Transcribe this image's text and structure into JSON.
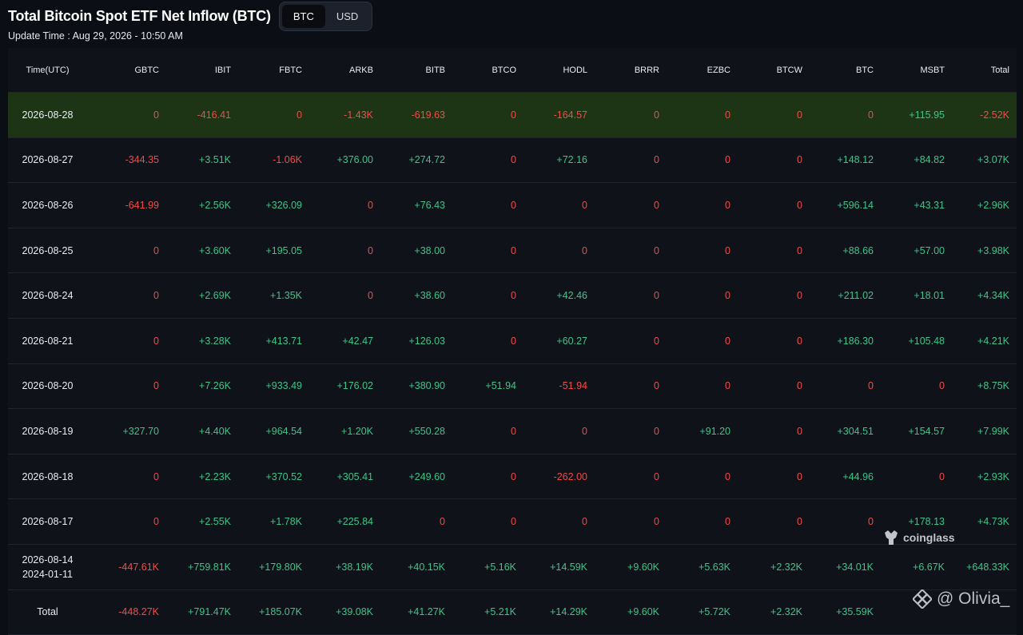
{
  "header": {
    "title": "Total Bitcoin Spot ETF Net Inflow (BTC)",
    "toggle": [
      "BTC",
      "USD"
    ],
    "active": "BTC",
    "update_time": "Update Time : Aug 29, 2026 - 10:50 AM"
  },
  "columns": [
    "Time(UTC)",
    "GBTC",
    "IBIT",
    "FBTC",
    "ARKB",
    "BITB",
    "BTCO",
    "HODL",
    "BRRR",
    "EZBC",
    "BTCW",
    "BTC",
    "MSBT",
    "Total"
  ],
  "rows": [
    {
      "date": "2026-08-28",
      "values": [
        "0",
        "-416.41",
        "0",
        "-1.43K",
        "-619.63",
        "0",
        "-164.57",
        "0",
        "0",
        "0",
        "0",
        "+115.95",
        "-2.52K"
      ]
    },
    {
      "date": "2026-08-27",
      "values": [
        "-344.35",
        "+3.51K",
        "-1.06K",
        "+376.00",
        "+274.72",
        "0",
        "+72.16",
        "0",
        "0",
        "0",
        "+148.12",
        "+84.82",
        "+3.07K"
      ]
    },
    {
      "date": "2026-08-26",
      "values": [
        "-641.99",
        "+2.56K",
        "+326.09",
        "0",
        "+76.43",
        "0",
        "0",
        "0",
        "0",
        "0",
        "+596.14",
        "+43.31",
        "+2.96K"
      ]
    },
    {
      "date": "2026-08-25",
      "values": [
        "0",
        "+3.60K",
        "+195.05",
        "0",
        "+38.00",
        "0",
        "0",
        "0",
        "0",
        "0",
        "+88.66",
        "+57.00",
        "+3.98K"
      ]
    },
    {
      "date": "2026-08-24",
      "values": [
        "0",
        "+2.69K",
        "+1.35K",
        "0",
        "+38.60",
        "0",
        "+42.46",
        "0",
        "0",
        "0",
        "+211.02",
        "+18.01",
        "+4.34K"
      ]
    },
    {
      "date": "2026-08-21",
      "values": [
        "0",
        "+3.28K",
        "+413.71",
        "+42.47",
        "+126.03",
        "0",
        "+60.27",
        "0",
        "0",
        "0",
        "+186.30",
        "+105.48",
        "+4.21K"
      ]
    },
    {
      "date": "2026-08-20",
      "values": [
        "0",
        "+7.26K",
        "+933.49",
        "+176.02",
        "+380.90",
        "+51.94",
        "-51.94",
        "0",
        "0",
        "0",
        "0",
        "0",
        "+8.75K"
      ]
    },
    {
      "date": "2026-08-19",
      "values": [
        "+327.70",
        "+4.40K",
        "+964.54",
        "+1.20K",
        "+550.28",
        "0",
        "0",
        "0",
        "+91.20",
        "0",
        "+304.51",
        "+154.57",
        "+7.99K"
      ]
    },
    {
      "date": "2026-08-18",
      "values": [
        "0",
        "+2.23K",
        "+370.52",
        "+305.41",
        "+249.60",
        "0",
        "-262.00",
        "0",
        "0",
        "0",
        "+44.96",
        "0",
        "+2.93K"
      ]
    },
    {
      "date": "2026-08-17",
      "values": [
        "0",
        "+2.55K",
        "+1.78K",
        "+225.84",
        "0",
        "0",
        "0",
        "0",
        "0",
        "0",
        "0",
        "+178.13",
        "+4.73K"
      ]
    }
  ],
  "range_row": {
    "date_from": "2026-08-14",
    "date_to": "2024-01-11",
    "values": [
      "-447.61K",
      "+759.81K",
      "+179.80K",
      "+38.19K",
      "+40.15K",
      "+5.16K",
      "+14.59K",
      "+9.60K",
      "+5.63K",
      "+2.32K",
      "+34.01K",
      "+6.67K",
      "+648.33K"
    ]
  },
  "total_row": {
    "label": "Total",
    "values": [
      "-448.27K",
      "+791.47K",
      "+185.07K",
      "+39.08K",
      "+41.27K",
      "+5.21K",
      "+14.29K",
      "+9.60K",
      "+5.72K",
      "+2.32K",
      "+35.59K",
      "",
      ""
    ]
  },
  "watermarks": {
    "coinglass": "coinglass",
    "olivia": "@ Olivia_"
  },
  "colors": {
    "positive": "#3ec48a",
    "negative": "#f04b4b",
    "highlight_row": "#1d3515",
    "background": "#0b0e14"
  }
}
